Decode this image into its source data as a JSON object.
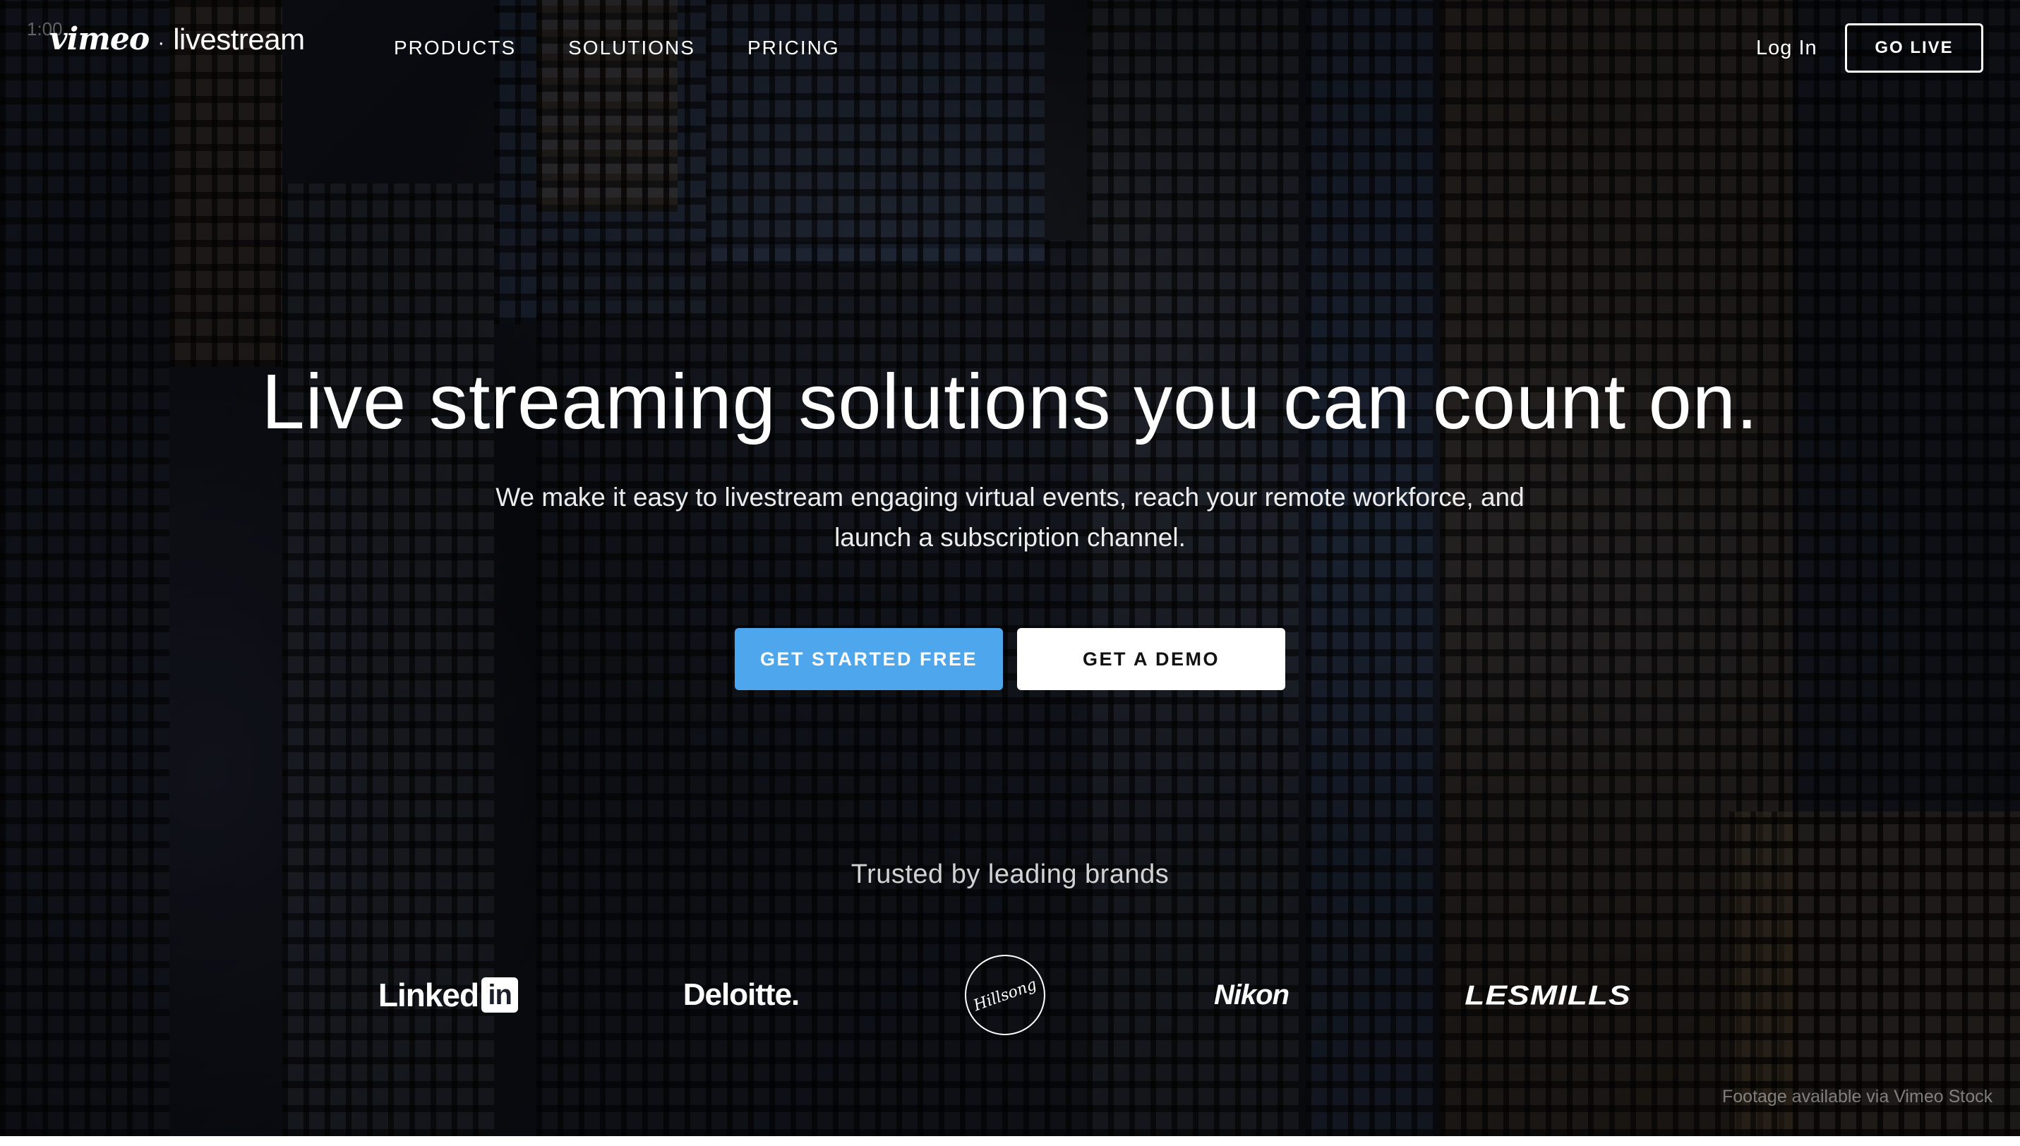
{
  "header": {
    "timecode": "1:00",
    "logo": {
      "brand": "vimeo",
      "separator": "·",
      "product": "livestream"
    },
    "nav": [
      {
        "label": "PRODUCTS"
      },
      {
        "label": "SOLUTIONS"
      },
      {
        "label": "PRICING"
      }
    ],
    "login_label": "Log In",
    "go_live_label": "GO LIVE"
  },
  "hero": {
    "headline": "Live streaming solutions you can count on.",
    "subline": "We make it easy to livestream engaging virtual events, reach your remote workforce, and launch a subscription channel.",
    "primary_cta": "GET STARTED FREE",
    "secondary_cta": "GET A DEMO",
    "primary_color": "#4ea6ec"
  },
  "brands": {
    "heading": "Trusted by leading brands",
    "logos": [
      {
        "name": "LinkedIn",
        "text": "Linked",
        "badge": "in"
      },
      {
        "name": "Deloitte",
        "text": "Deloitte."
      },
      {
        "name": "Hillsong",
        "text": "Hillsong"
      },
      {
        "name": "Nikon",
        "text": "Nikon"
      },
      {
        "name": "Les Mills",
        "text": "LESMILLS"
      }
    ]
  },
  "footer_note": "Footage available via Vimeo Stock"
}
